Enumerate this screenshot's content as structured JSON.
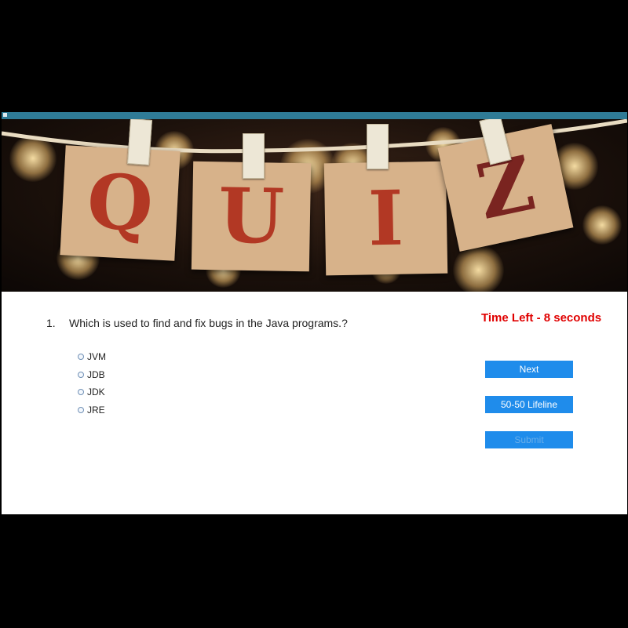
{
  "banner": {
    "letters": [
      "Q",
      "U",
      "I",
      "Z"
    ]
  },
  "question": {
    "number": "1.",
    "text": "Which is used to find and fix bugs in the Java programs.?"
  },
  "timer": {
    "text": "Time Left - 8 seconds",
    "color": "#e00000"
  },
  "options": [
    "JVM",
    "JDB",
    "JDK",
    "JRE"
  ],
  "buttons": {
    "next": "Next",
    "lifeline": "50-50 Lifeline",
    "submit": "Submit"
  },
  "colors": {
    "titlebar": "#2f7b96",
    "button": "#1f8ceb"
  }
}
